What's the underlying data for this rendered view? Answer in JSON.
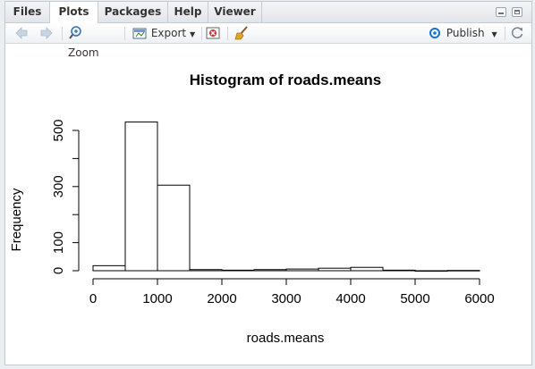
{
  "tabs": [
    {
      "label": "Files"
    },
    {
      "label": "Plots"
    },
    {
      "label": "Packages"
    },
    {
      "label": "Help"
    },
    {
      "label": "Viewer"
    }
  ],
  "toolbar": {
    "zoom_label": "Zoom",
    "export_label": "Export",
    "publish_label": "Publish"
  },
  "colors": {
    "accent": "#1a73c9",
    "tab_active": "#ffffff",
    "bar_fill": "#ffffff",
    "bar_stroke": "#000000"
  },
  "icons": [
    "back-arrow-icon",
    "forward-arrow-icon",
    "zoom-icon",
    "export-icon",
    "remove-plot-icon",
    "broom-icon",
    "publish-icon",
    "refresh-icon",
    "minimize-icon",
    "maximize-icon"
  ],
  "chart_data": {
    "type": "bar",
    "title": "Histogram of roads.means",
    "xlabel": "roads.means",
    "ylabel": "Frequency",
    "bin_edges": [
      0,
      500,
      1000,
      1500,
      2000,
      2500,
      3000,
      3500,
      4000,
      4500,
      5000,
      5500,
      6000
    ],
    "values": [
      18,
      530,
      305,
      4,
      2,
      4,
      6,
      9,
      12,
      2,
      0,
      1
    ],
    "xlim": [
      0,
      6000
    ],
    "ylim": [
      0,
      530
    ],
    "xticks": [
      0,
      1000,
      2000,
      3000,
      4000,
      5000,
      6000
    ],
    "yticks": [
      0,
      100,
      300,
      500
    ],
    "yticks_minor": [
      0,
      100,
      200,
      300,
      400,
      500
    ],
    "grid": false
  }
}
